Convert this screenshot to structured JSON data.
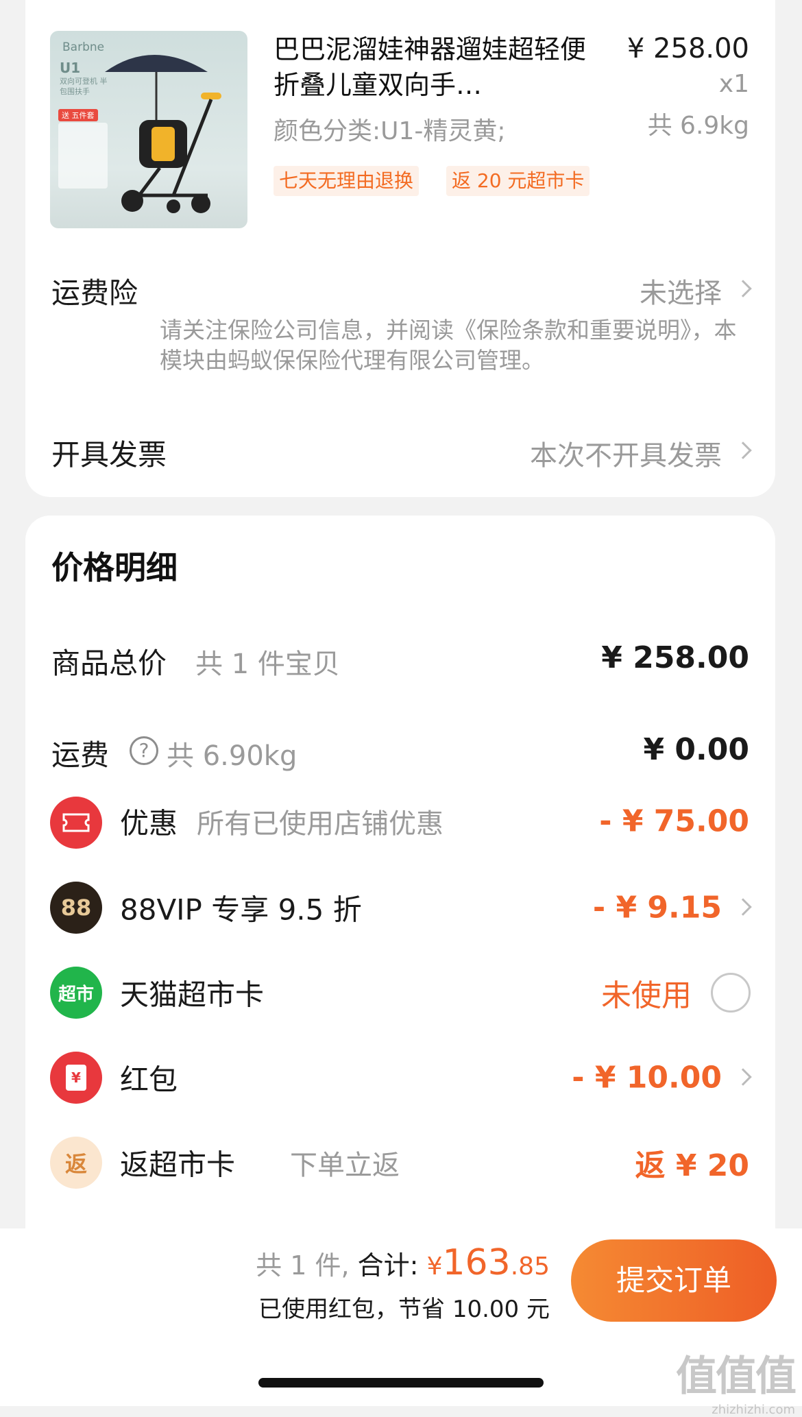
{
  "product": {
    "thumb": {
      "brand": "Barbne",
      "model": "U1",
      "desc": "双向可登机 半包围扶手",
      "gift": "送 五件套"
    },
    "title": "巴巴泥溜娃神器遛娃超轻便折叠儿童双向手…",
    "sku": "颜色分类:U1-精灵黄;",
    "price": "¥ 258.00",
    "qty": "x1",
    "weight": "共 6.9kg",
    "tags": [
      "七天无理由退换",
      "返 20 元超市卡"
    ]
  },
  "shipping_insurance": {
    "label": "运费险",
    "value": "未选择",
    "note": "请关注保险公司信息，并阅读《保险条款和重要说明》，本模块由蚂蚁保保险代理有限公司管理。"
  },
  "invoice": {
    "label": "开具发票",
    "value": "本次不开具发票"
  },
  "price_detail": {
    "title": "价格明细",
    "goods_total": {
      "label": "商品总价",
      "sub": "共 1 件宝贝",
      "amount": "¥ 258.00"
    },
    "freight": {
      "label": "运费",
      "sub": "共 6.90kg",
      "amount": "¥ 0.00"
    },
    "discount": {
      "label": "优惠",
      "sub": "所有已使用店铺优惠",
      "amount": "- ¥ 75.00"
    },
    "vip": {
      "icon_text": "88",
      "label": "88VIP 专享 9.5 折",
      "amount": "- ¥ 9.15"
    },
    "tmall_card": {
      "icon_text": "超市",
      "label": "天猫超市卡",
      "status": "未使用"
    },
    "red_packet": {
      "icon_text": "¥",
      "label": "红包",
      "amount": "- ¥ 10.00"
    },
    "rebate": {
      "icon_text": "返",
      "label": "返超市卡",
      "sub": "下单立返",
      "amount": "返 ¥ 20"
    }
  },
  "footer": {
    "count": "共 1 件,",
    "total_label": "合计:",
    "currency": "¥",
    "total_int": "163",
    "total_dec": ".85",
    "saved": "已使用红包，节省 10.00 元",
    "submit": "提交订单",
    "watermark_cn": "值值值",
    "watermark_en": "zhizhizhi.com"
  },
  "colors": {
    "accent": "#f1652a",
    "muted": "#9a9a9a",
    "tag_bg": "#fdf0e8"
  }
}
